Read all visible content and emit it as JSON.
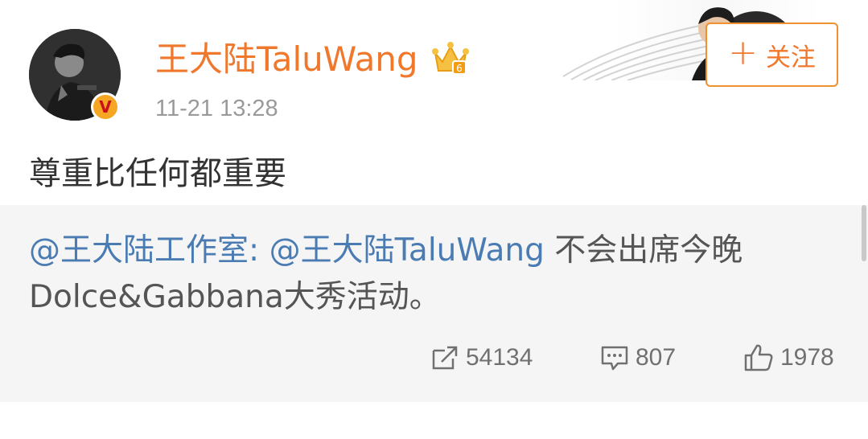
{
  "post": {
    "username": "王大陆TaluWang",
    "timestamp": "11-21 13:28",
    "follow_label": "关注",
    "text": "尊重比任何都重要"
  },
  "repost": {
    "author_mention": "@王大陆工作室",
    "separator": ": ",
    "target_mention": "@王大陆TaluWang",
    "body": " 不会出席今晚Dolce&Gabbana大秀活动。"
  },
  "actions": {
    "reposts": "54134",
    "comments": "807",
    "likes": "1978"
  },
  "icons": {
    "verified_badge": "V",
    "crown": "crown-icon",
    "repost": "share-icon",
    "comment": "comment-icon",
    "like": "thumbs-up-icon"
  },
  "colors": {
    "username": "#f0782d",
    "mention": "#4a7cb3",
    "follow_border": "#f0902f",
    "repost_bg": "#f5f5f5"
  }
}
